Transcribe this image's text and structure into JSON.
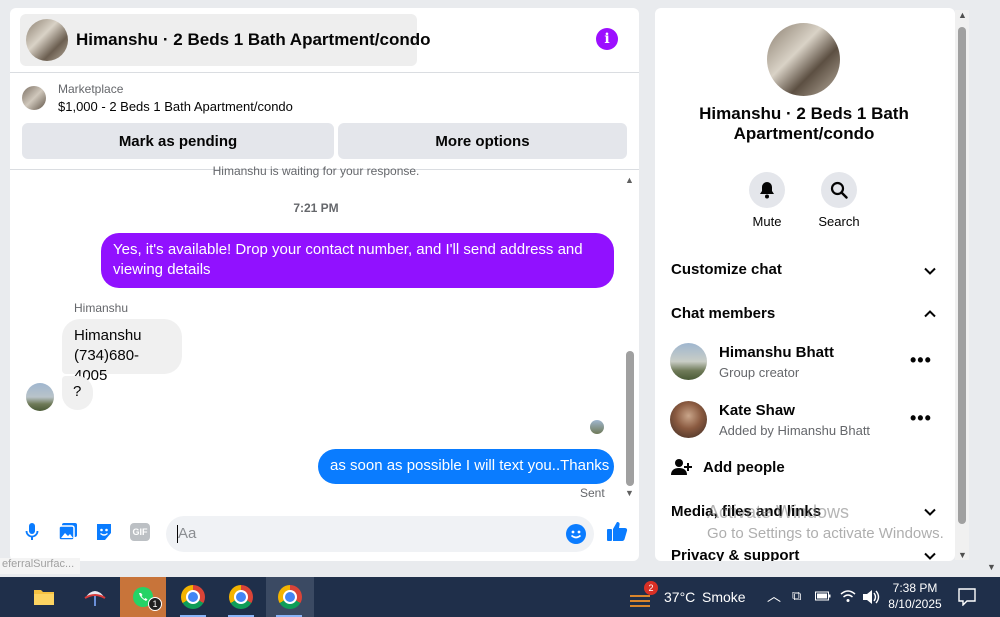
{
  "chat": {
    "title": "Himanshu · 2 Beds 1 Bath Apartment/condo",
    "marketplace_label": "Marketplace",
    "listing": "$1,000 - 2 Beds 1 Bath Apartment/condo",
    "mark_pending_label": "Mark as pending",
    "more_options_label": "More options",
    "waiting_text": "Himanshu is waiting for your response.",
    "timestamp": "7:21 PM",
    "messages": [
      {
        "from": "me",
        "text": "Yes, it's available! Drop your contact number, and I'll send address and viewing details"
      },
      {
        "from": "Himanshu",
        "text": "Himanshu\n(734)680-4005"
      },
      {
        "from": "Himanshu",
        "text": "?"
      },
      {
        "from": "me",
        "text": "as soon as possible I will text you..Thanks"
      }
    ],
    "sender_name": "Himanshu",
    "sent_status": "Sent",
    "composer_placeholder": "Aa",
    "gif_label": "GIF"
  },
  "side": {
    "title": "Himanshu · 2 Beds 1 Bath Apartment/condo",
    "mute_label": "Mute",
    "search_label": "Search",
    "customize_label": "Customize chat",
    "members_label": "Chat members",
    "members": [
      {
        "name": "Himanshu Bhatt",
        "role": "Group creator"
      },
      {
        "name": "Kate Shaw",
        "role": "Added by Himanshu Bhatt"
      }
    ],
    "add_people_label": "Add people",
    "media_label": "Media, files and links",
    "privacy_label": "Privacy & support"
  },
  "watermark": {
    "line1": "Activate Windows",
    "line2": "Go to Settings to activate Windows."
  },
  "referral_text": "eferralSurfac...",
  "taskbar": {
    "whatsapp_badge": "1",
    "weather_badge": "2",
    "temperature": "37°C",
    "weather": "Smoke",
    "time": "7:38 PM",
    "date": "8/10/2025"
  },
  "colors": {
    "accent_purple": "#9111ff",
    "accent_blue": "#0a7cff",
    "taskbar": "#1f2f4a"
  }
}
